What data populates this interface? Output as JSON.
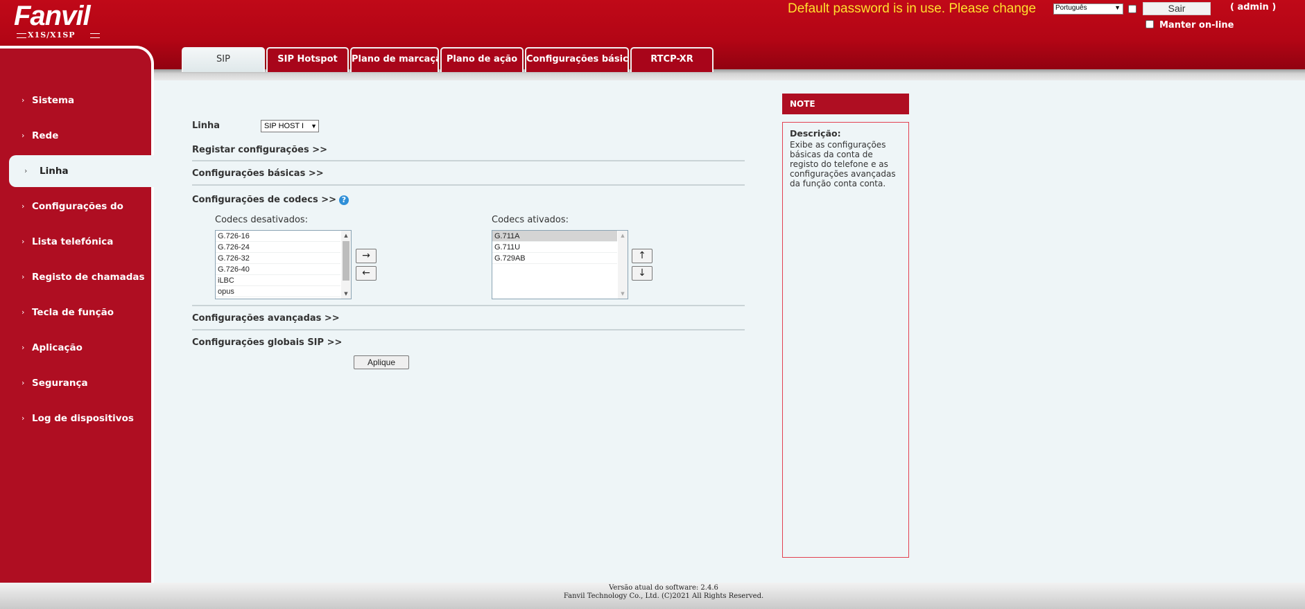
{
  "header": {
    "brand": "Fanvil",
    "model": "X1S/X1SP",
    "password_warning": "Default password is in use. Please change",
    "language_selected": "Português",
    "logout_label": "Sair",
    "user_label": "( admin )",
    "keep_online_label": "Manter on-line"
  },
  "tabs": [
    {
      "label": "SIP",
      "active": true
    },
    {
      "label": "SIP Hotspot"
    },
    {
      "label": "Plano de marcação"
    },
    {
      "label": "Plano de ação"
    },
    {
      "label": "Configurações básicas"
    },
    {
      "label": "RTCP-XR"
    }
  ],
  "sidebar": {
    "items": [
      {
        "label": "Sistema"
      },
      {
        "label": "Rede"
      },
      {
        "label": "Linha",
        "active": true
      },
      {
        "label": "Configurações do"
      },
      {
        "label": "Lista telefónica"
      },
      {
        "label": "Registo de chamadas"
      },
      {
        "label": "Tecla de função"
      },
      {
        "label": "Aplicação"
      },
      {
        "label": "Segurança"
      },
      {
        "label": "Log de dispositivos"
      }
    ]
  },
  "main": {
    "line_label": "Linha",
    "line_value": "SIP HOST I",
    "sections": {
      "register": "Registar configurações >>",
      "basic": "Configurações básicas >>",
      "codecs": "Configurações de codecs >>",
      "advanced": "Configurações avançadas >>",
      "global_sip": "Configurações globais SIP >>"
    },
    "codecs_disabled_title": "Codecs desativados:",
    "codecs_disabled": [
      "G.726-16",
      "G.726-24",
      "G.726-32",
      "G.726-40",
      "iLBC",
      "opus"
    ],
    "codecs_enabled_title": "Codecs ativados:",
    "codecs_enabled": [
      "G.711A",
      "G.711U",
      "G.729AB"
    ],
    "move_right": "→",
    "move_left": "←",
    "move_up": "↑",
    "move_down": "↓",
    "apply_label": "Aplique"
  },
  "note": {
    "header": "NOTE",
    "title": "Descrição:",
    "text": "Exibe as configurações básicas da conta de registo do telefone e as configurações avançadas da função conta conta."
  },
  "footer": {
    "version": "Versão atual do software: 2.4.6",
    "copyright": "Fanvil Technology Co., Ltd. (C)2021 All Rights Reserved."
  },
  "colors": {
    "brand_red": "#af0e22",
    "warning_yellow": "#ffe02e",
    "background": "#eef5f7"
  }
}
